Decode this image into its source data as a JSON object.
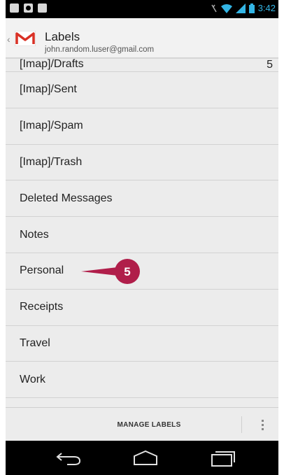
{
  "status_bar": {
    "time": "3:42",
    "left_icons": [
      "gallery-icon",
      "gamepad-icon",
      "gallery-icon"
    ],
    "right_icons": [
      "vibrate-icon",
      "wifi-icon",
      "signal-icon",
      "battery-icon"
    ]
  },
  "action_bar": {
    "title": "Labels",
    "account": "john.random.luser@gmail.com"
  },
  "labels": [
    {
      "name": "[Imap]/Drafts",
      "count": "5"
    },
    {
      "name": "[Imap]/Sent",
      "count": ""
    },
    {
      "name": "[Imap]/Spam",
      "count": ""
    },
    {
      "name": "[Imap]/Trash",
      "count": ""
    },
    {
      "name": "Deleted Messages",
      "count": ""
    },
    {
      "name": "Notes",
      "count": ""
    },
    {
      "name": "Personal",
      "count": ""
    },
    {
      "name": "Receipts",
      "count": ""
    },
    {
      "name": "Travel",
      "count": ""
    },
    {
      "name": "Work",
      "count": ""
    }
  ],
  "callout": {
    "label": "5",
    "color": "#b01e4a"
  },
  "manage_bar": {
    "manage_label": "MANAGE LABELS"
  },
  "colors": {
    "accent_blue": "#33b5e5",
    "gmail_red": "#d93025"
  }
}
